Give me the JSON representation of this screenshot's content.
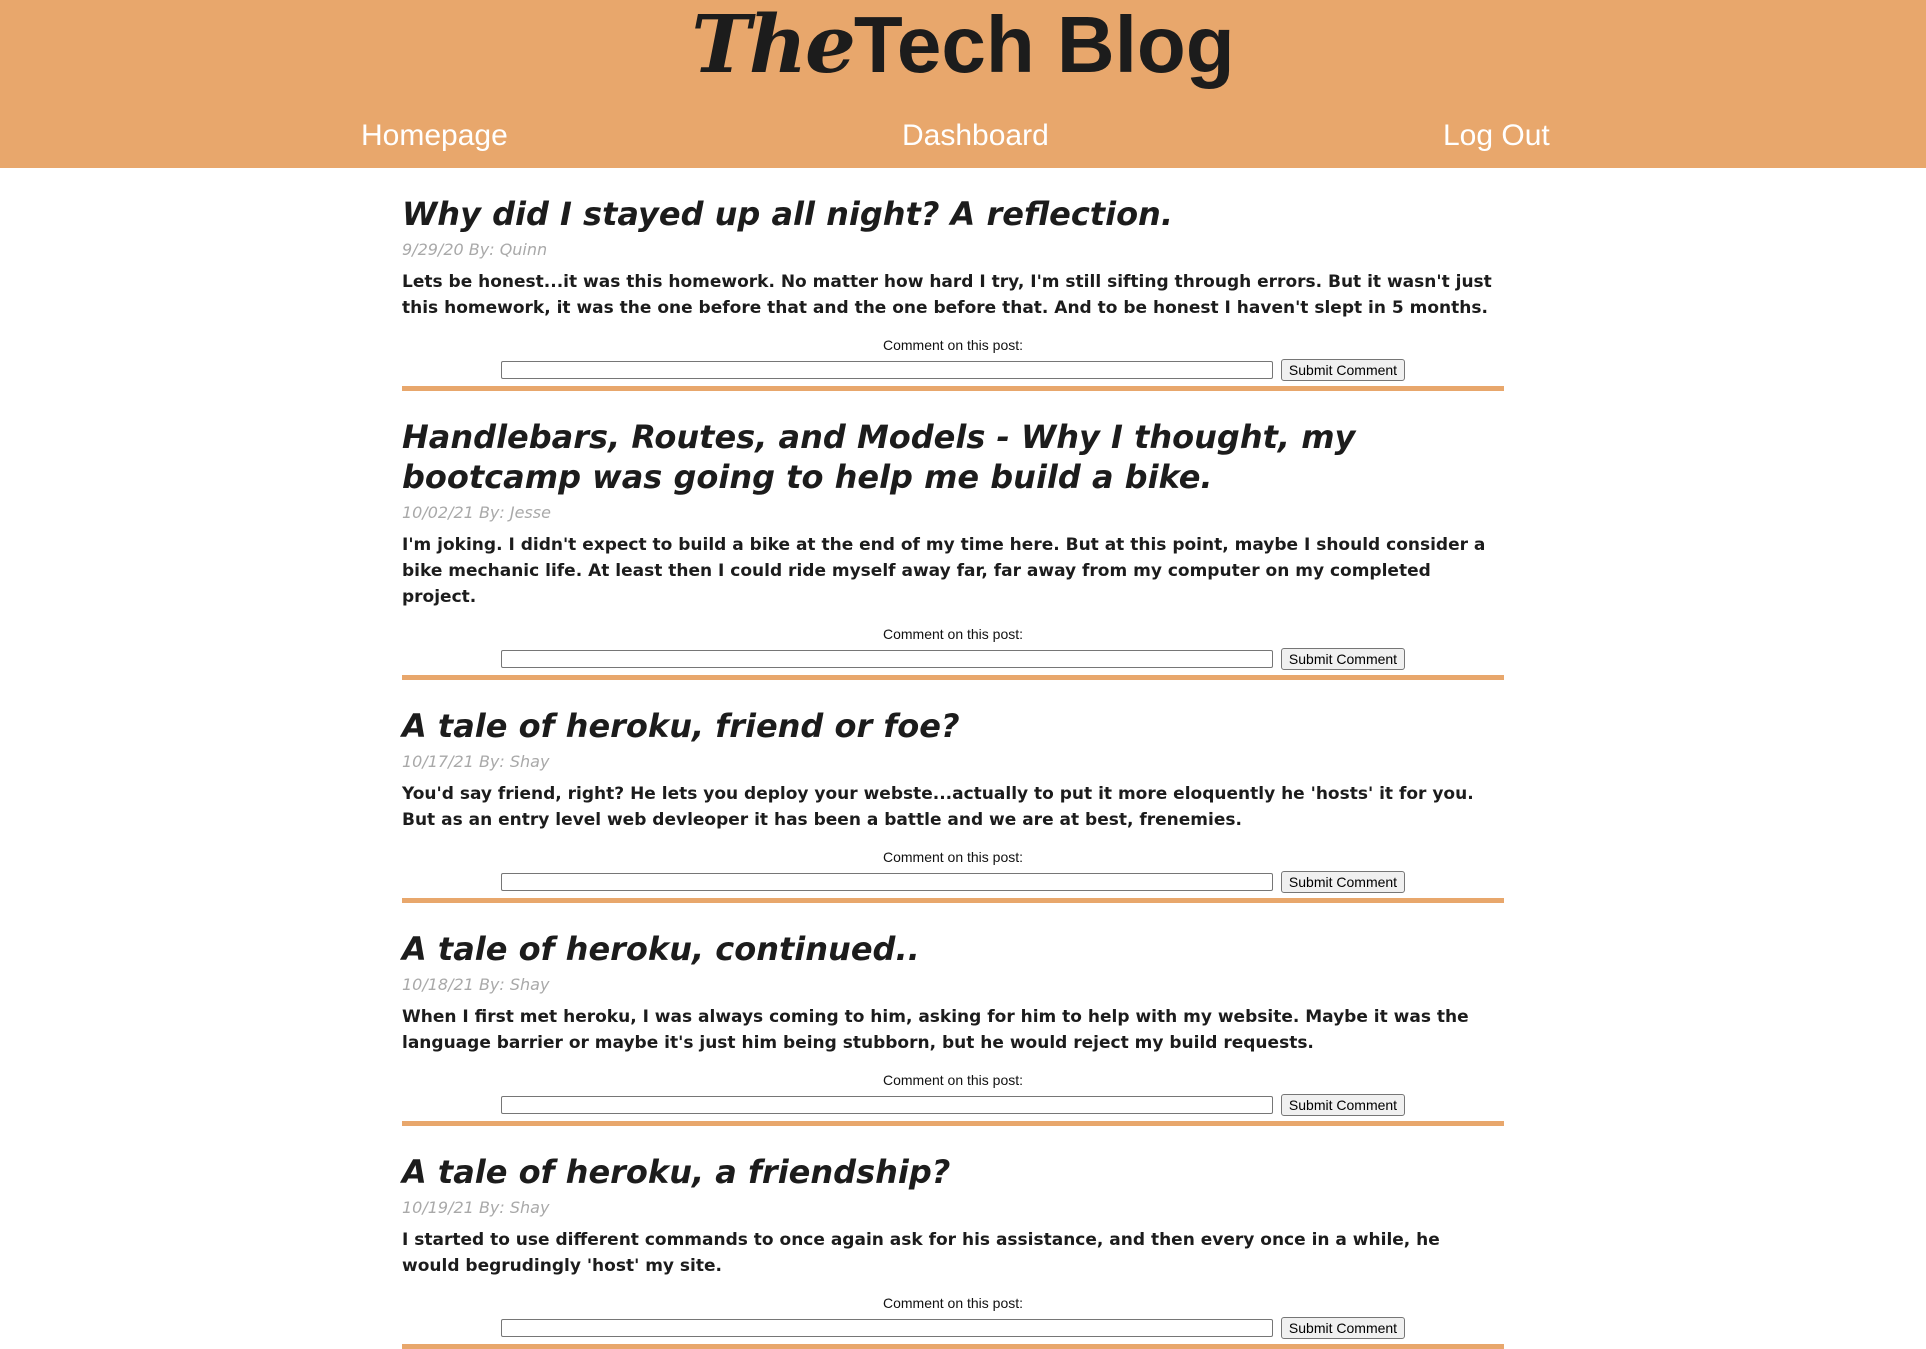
{
  "header": {
    "logo_the": "The",
    "logo_tech_blog": "Tech Blog",
    "nav": {
      "homepage": "Homepage",
      "dashboard": "Dashboard",
      "logout": "Log Out"
    }
  },
  "comment_label": "Comment on this post:",
  "comment_button": "Submit Comment",
  "posts": [
    {
      "title": "Why did I stayed up all night? A reflection.",
      "meta": "9/29/20 By: Quinn",
      "body": "Lets be honest...it was this homework. No matter how hard I try, I'm still sifting through errors. But it wasn't just this homework, it was the one before that and the one before that. And to be honest I haven't slept in 5 months."
    },
    {
      "title": "Handlebars, Routes, and Models - Why I thought, my bootcamp was going to help me build a bike.",
      "meta": "10/02/21 By: Jesse",
      "body": "I'm joking. I didn't expect to build a bike at the end of my time here. But at this point, maybe I should consider a bike mechanic life. At least then I could ride myself away far, far away from my computer on my completed project."
    },
    {
      "title": "A tale of heroku, friend or foe?",
      "meta": "10/17/21 By: Shay",
      "body": "You'd say friend, right? He lets you deploy your webste...actually to put it more eloquently he 'hosts' it for you. But as an entry level web devleoper it has been a battle and we are at best, frenemies."
    },
    {
      "title": "A tale of heroku, continued..",
      "meta": "10/18/21 By: Shay",
      "body": "When I first met heroku, I was always coming to him, asking for him to help with my website. Maybe it was the language barrier or maybe it's just him being stubborn, but he would reject my build requests."
    },
    {
      "title": "A tale of heroku, a friendship?",
      "meta": "10/19/21 By: Shay",
      "body": "I started to use different commands to once again ask for his assistance, and then every once in a while, he would begrudingly 'host' my site."
    }
  ],
  "colors": {
    "header_bg": "#e8a76c",
    "divider": "#e8a76c",
    "meta_text": "#a9a9a9"
  }
}
